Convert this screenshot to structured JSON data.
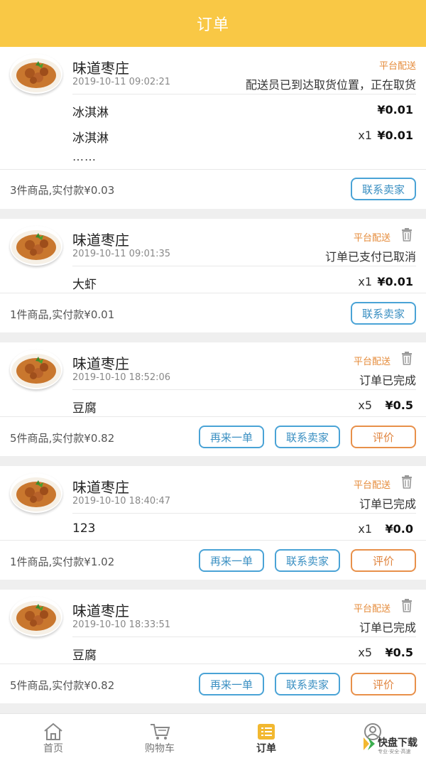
{
  "header": {
    "title": "订单"
  },
  "orders": [
    {
      "shop_name": "味道枣庄",
      "time": "2019-10-11 09:02:21",
      "delivery": "平台配送",
      "status": "配送员已到达取货位置，正在取货",
      "items": [
        {
          "name": "冰淇淋",
          "qty": "",
          "price": "¥0.01"
        },
        {
          "name": "冰淇淋",
          "qty": "x1",
          "price": "¥0.01"
        }
      ],
      "more": "……",
      "summary": "3件商品,实付款¥0.03",
      "buttons": [
        "联系卖家"
      ]
    },
    {
      "shop_name": "味道枣庄",
      "time": "2019-10-11 09:01:35",
      "delivery": "平台配送",
      "status": "订单已支付已取消",
      "items": [
        {
          "name": "大虾",
          "qty": "x1",
          "price": "¥0.01"
        }
      ],
      "summary": "1件商品,实付款¥0.01",
      "buttons": [
        "联系卖家"
      ]
    },
    {
      "shop_name": "味道枣庄",
      "time": "2019-10-10 18:52:06",
      "delivery": "平台配送",
      "status": "订单已完成",
      "items": [
        {
          "name": "豆腐",
          "qty": "x5",
          "price": "¥0.5"
        }
      ],
      "summary": "5件商品,实付款¥0.82",
      "buttons": [
        "再来一单",
        "联系卖家",
        "评价"
      ]
    },
    {
      "shop_name": "味道枣庄",
      "time": "2019-10-10 18:40:47",
      "delivery": "平台配送",
      "status": "订单已完成",
      "items": [
        {
          "name": "123",
          "qty": "x1",
          "price": "¥0.0"
        }
      ],
      "summary": "1件商品,实付款¥1.02",
      "buttons": [
        "再来一单",
        "联系卖家",
        "评价"
      ]
    },
    {
      "shop_name": "味道枣庄",
      "time": "2019-10-10 18:33:51",
      "delivery": "平台配送",
      "status": "订单已完成",
      "items": [
        {
          "name": "豆腐",
          "qty": "x5",
          "price": "¥0.5"
        }
      ],
      "summary": "5件商品,实付款¥0.82",
      "buttons": [
        "再来一单",
        "联系卖家",
        "评价"
      ]
    }
  ],
  "tabbar": [
    {
      "label": "首页",
      "icon": "home-icon"
    },
    {
      "label": "购物车",
      "icon": "cart-icon"
    },
    {
      "label": "订单",
      "icon": "orders-icon",
      "active": true
    },
    {
      "label": "",
      "icon": "profile-icon"
    }
  ],
  "watermark": {
    "text": "快盘下载",
    "sub": "专业·安全·高速"
  },
  "colors": {
    "header": "#f9c845",
    "delivery": "#e58b3a",
    "blue_button": "#4aa3d6",
    "orange_button": "#e8904a",
    "active_tab_icon": "#f2b830"
  }
}
